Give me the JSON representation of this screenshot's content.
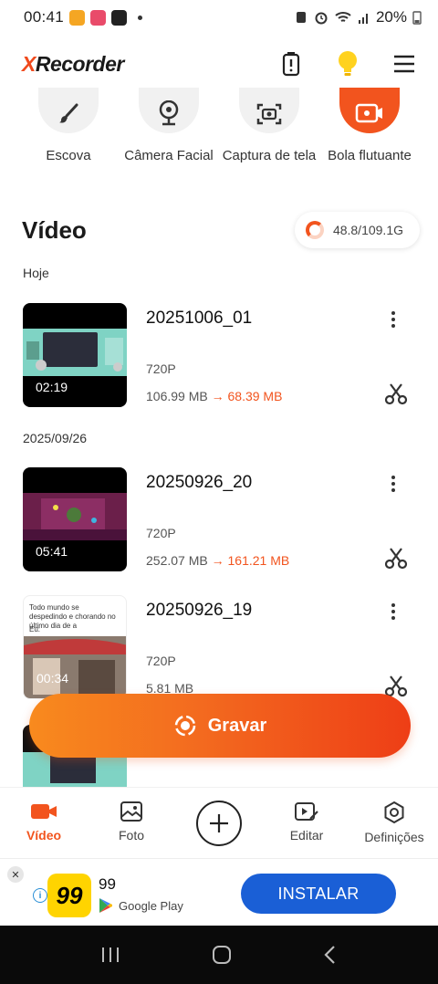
{
  "status_bar": {
    "time": "00:41",
    "battery": "20%"
  },
  "header": {
    "logo_prefix": "X",
    "logo_rest": "Recorder",
    "icons": [
      "battery-icon",
      "lightbulb-icon",
      "menu-icon"
    ]
  },
  "tools": [
    {
      "label": "Escova",
      "icon": "brush-icon"
    },
    {
      "label": "Câmera Facial",
      "icon": "webcam-icon"
    },
    {
      "label": "Captura de tela",
      "icon": "screenshot-icon"
    },
    {
      "label": "Bola flutuante",
      "icon": "floating-ball-icon"
    }
  ],
  "section": {
    "title": "Vídeo",
    "storage": "48.8/109.1G",
    "storage_used_fraction": 0.447
  },
  "groups": [
    {
      "date": "Hoje"
    },
    {
      "date": "2025/09/26"
    }
  ],
  "videos": [
    {
      "name": "20251006_01",
      "resolution": "720P",
      "size": "106.99 MB",
      "arrow": "→",
      "new_size": "68.39 MB",
      "duration": "02:19"
    },
    {
      "name": "20250926_20",
      "resolution": "720P",
      "size": "252.07 MB",
      "arrow": "→",
      "new_size": "161.21 MB",
      "duration": "05:41"
    },
    {
      "name": "20250926_19",
      "resolution": "720P",
      "size": "5.81 MB",
      "duration": "00:34",
      "thumb_caption": "Todo mundo se despedindo e chorando no último dia de a",
      "thumb_caption_2": "Eu:"
    }
  ],
  "record": {
    "label": "Gravar"
  },
  "nav": [
    {
      "label": "Vídeo",
      "icon": "video-camera-icon",
      "active": true
    },
    {
      "label": "Foto",
      "icon": "photo-icon"
    },
    {
      "label": "Editar",
      "icon": "edit-video-icon"
    },
    {
      "label": "Definições",
      "icon": "settings-icon"
    }
  ],
  "ad": {
    "logo": "99",
    "name": "99",
    "store": "Google Play",
    "install": "INSTALAR"
  },
  "colors": {
    "accent": "#f2541e",
    "install_blue": "#1a5fd6"
  }
}
